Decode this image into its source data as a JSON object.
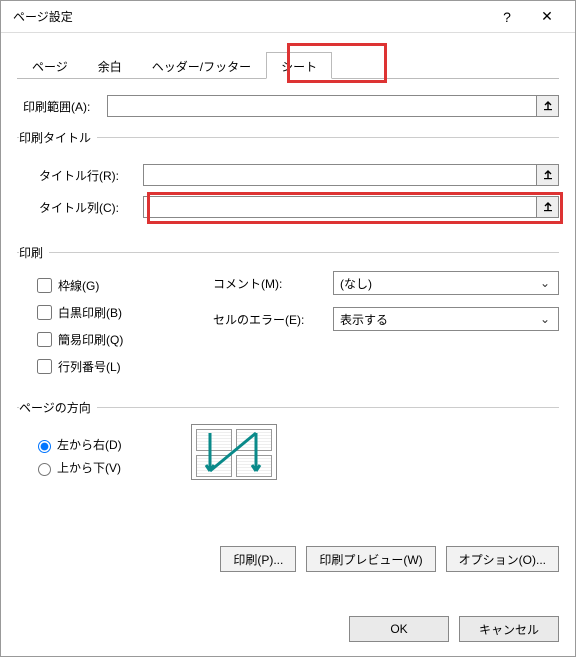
{
  "window": {
    "title": "ページ設定",
    "help": "?",
    "close": "✕"
  },
  "tabs": {
    "page": "ページ",
    "margin": "余白",
    "headerfooter": "ヘッダー/フッター",
    "sheet": "シート"
  },
  "print_area": {
    "label": "印刷範囲(A):",
    "value": ""
  },
  "print_titles": {
    "legend": "印刷タイトル",
    "rows_label": "タイトル行(R):",
    "rows_value": "",
    "cols_label": "タイトル列(C):",
    "cols_value": ""
  },
  "print": {
    "legend": "印刷",
    "gridlines": "枠線(G)",
    "bw": "白黒印刷(B)",
    "draft": "簡易印刷(Q)",
    "rowcol": "行列番号(L)",
    "comments_label": "コメント(M):",
    "comments_value": "(なし)",
    "errors_label": "セルのエラー(E):",
    "errors_value": "表示する"
  },
  "page_order": {
    "legend": "ページの方向",
    "ltr": "左から右(D)",
    "ttb": "上から下(V)"
  },
  "buttons": {
    "print": "印刷(P)...",
    "preview": "印刷プレビュー(W)",
    "options": "オプション(O)...",
    "ok": "OK",
    "cancel": "キャンセル"
  }
}
